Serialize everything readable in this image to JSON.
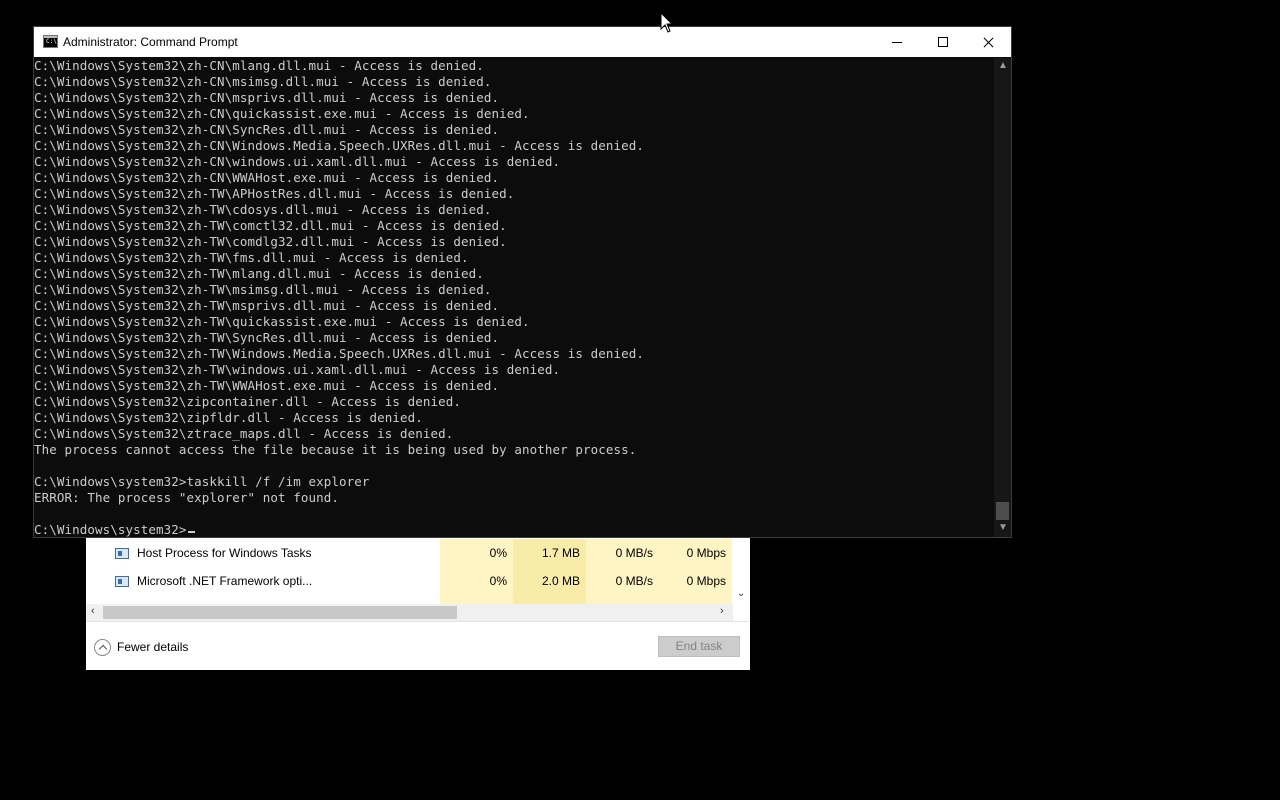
{
  "cmd_window": {
    "title": "Administrator: Command Prompt",
    "icon": "cmd-icon",
    "icon_text": "C:\\",
    "controls": {
      "minimize": "minimize-icon",
      "maximize": "maximize-icon",
      "close": "close-icon"
    },
    "lines": [
      "C:\\Windows\\System32\\zh-CN\\mlang.dll.mui - Access is denied.",
      "C:\\Windows\\System32\\zh-CN\\msimsg.dll.mui - Access is denied.",
      "C:\\Windows\\System32\\zh-CN\\msprivs.dll.mui - Access is denied.",
      "C:\\Windows\\System32\\zh-CN\\quickassist.exe.mui - Access is denied.",
      "C:\\Windows\\System32\\zh-CN\\SyncRes.dll.mui - Access is denied.",
      "C:\\Windows\\System32\\zh-CN\\Windows.Media.Speech.UXRes.dll.mui - Access is denied.",
      "C:\\Windows\\System32\\zh-CN\\windows.ui.xaml.dll.mui - Access is denied.",
      "C:\\Windows\\System32\\zh-CN\\WWAHost.exe.mui - Access is denied.",
      "C:\\Windows\\System32\\zh-TW\\APHostRes.dll.mui - Access is denied.",
      "C:\\Windows\\System32\\zh-TW\\cdosys.dll.mui - Access is denied.",
      "C:\\Windows\\System32\\zh-TW\\comctl32.dll.mui - Access is denied.",
      "C:\\Windows\\System32\\zh-TW\\comdlg32.dll.mui - Access is denied.",
      "C:\\Windows\\System32\\zh-TW\\fms.dll.mui - Access is denied.",
      "C:\\Windows\\System32\\zh-TW\\mlang.dll.mui - Access is denied.",
      "C:\\Windows\\System32\\zh-TW\\msimsg.dll.mui - Access is denied.",
      "C:\\Windows\\System32\\zh-TW\\msprivs.dll.mui - Access is denied.",
      "C:\\Windows\\System32\\zh-TW\\quickassist.exe.mui - Access is denied.",
      "C:\\Windows\\System32\\zh-TW\\SyncRes.dll.mui - Access is denied.",
      "C:\\Windows\\System32\\zh-TW\\Windows.Media.Speech.UXRes.dll.mui - Access is denied.",
      "C:\\Windows\\System32\\zh-TW\\windows.ui.xaml.dll.mui - Access is denied.",
      "C:\\Windows\\System32\\zh-TW\\WWAHost.exe.mui - Access is denied.",
      "C:\\Windows\\System32\\zipcontainer.dll - Access is denied.",
      "C:\\Windows\\System32\\zipfldr.dll - Access is denied.",
      "C:\\Windows\\System32\\ztrace_maps.dll - Access is denied.",
      "The process cannot access the file because it is being used by another process.",
      "",
      "C:\\Windows\\system32>taskkill /f /im explorer",
      "ERROR: The process \"explorer\" not found.",
      ""
    ],
    "prompt": "C:\\Windows\\system32>"
  },
  "task_manager": {
    "rows": [
      {
        "name": "Host Process for Windows Tasks",
        "icon": "process-icon",
        "cpu": "0%",
        "memory": "1.7 MB",
        "disk": "0 MB/s",
        "network": "0 Mbps"
      },
      {
        "name": "Microsoft .NET Framework opti...",
        "icon": "process-icon",
        "cpu": "0%",
        "memory": "2.0 MB",
        "disk": "0 MB/s",
        "network": "0 Mbps"
      }
    ],
    "fewer_details_label": "Fewer details",
    "end_task_label": "End task"
  },
  "colors": {
    "console_bg": "#0c0c0c",
    "console_text": "#cccccc",
    "cpu_highlight": "#fff4c4",
    "memory_highlight": "#f9eca8"
  }
}
